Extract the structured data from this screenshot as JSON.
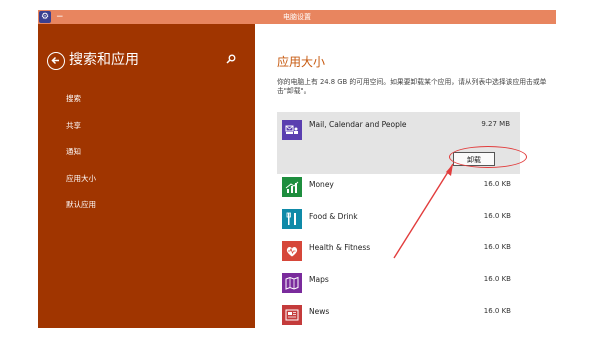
{
  "window": {
    "title": "电脑设置",
    "app_icon": "gear-icon",
    "minimize": "−"
  },
  "sidebar": {
    "title": "搜索和应用",
    "items": [
      "搜索",
      "共享",
      "通知",
      "应用大小",
      "默认应用"
    ]
  },
  "main": {
    "title": "应用大小",
    "description": "你的电脑上有 24.8 GB 的可用空间。如果要卸载某个应用，请从列表中选择该应用击或单击\"卸载\"。",
    "uninstall_label": "卸载",
    "apps": [
      {
        "name": "Mail, Calendar and People",
        "size": "9.27 MB",
        "color": "#5a3fb0",
        "icon": "mail-people-icon"
      },
      {
        "name": "Money",
        "size": "16.0 KB",
        "color": "#1e8e3e",
        "icon": "chart-icon"
      },
      {
        "name": "Food & Drink",
        "size": "16.0 KB",
        "color": "#0f8aa8",
        "icon": "fork-knife-icon"
      },
      {
        "name": "Health & Fitness",
        "size": "16.0 KB",
        "color": "#d6473a",
        "icon": "heart-icon"
      },
      {
        "name": "Maps",
        "size": "16.0 KB",
        "color": "#7a2b9c",
        "icon": "map-icon"
      },
      {
        "name": "News",
        "size": "16.0 KB",
        "color": "#c43b3b",
        "icon": "news-icon"
      }
    ]
  },
  "colors": {
    "titlebar": "#e8855f",
    "sidebar": "#a03500",
    "accent": "#c75a10",
    "annotation": "#e23d3d"
  }
}
